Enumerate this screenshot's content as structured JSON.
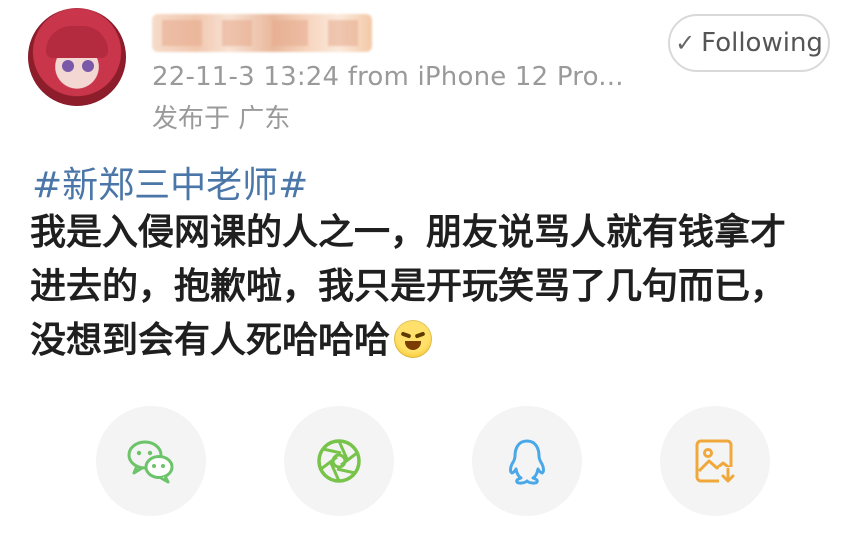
{
  "post": {
    "meta": "22-11-3 13:24  from iPhone 12 Pro...",
    "location": "发布于 广东",
    "follow_label": "Following",
    "hashtag": "#新郑三中老师#",
    "content": "我是入侵网课的人之一，朋友说骂人就有钱拿才进去的，抱歉啦，我只是开玩笑骂了几句而已，没想到会有人死哈哈哈"
  },
  "share": {
    "items": [
      {
        "icon": "wechat-icon",
        "color": "#6cc36a"
      },
      {
        "icon": "moments-icon",
        "color": "#78c34a"
      },
      {
        "icon": "qq-icon",
        "color": "#4aa8e8"
      },
      {
        "icon": "save-image-icon",
        "color": "#f0a73b"
      }
    ]
  }
}
